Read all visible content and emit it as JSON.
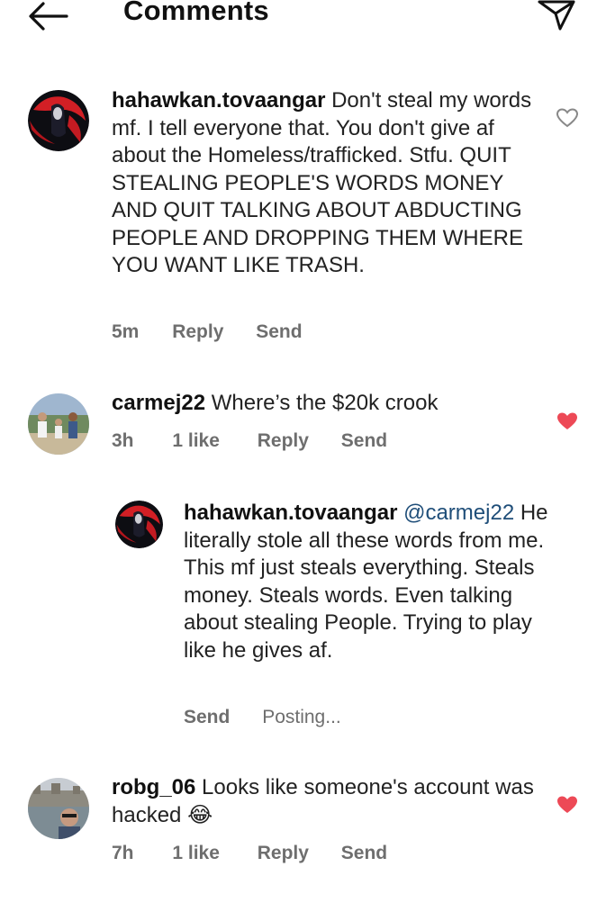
{
  "header": {
    "title": "Comments"
  },
  "comments": [
    {
      "username": "hahawkan.tovaangar",
      "text": "Don't steal my words mf. I tell everyone that. You don't give af about the Homeless/trafficked. Stfu. QUIT STEALING PEOPLE'S WORDS MONEY AND QUIT TALKING ABOUT ABDUCTING PEOPLE AND DROPPING THEM WHERE YOU WANT LIKE TRASH.",
      "time": "5m",
      "reply": "Reply",
      "send": "Send",
      "liked": false
    },
    {
      "username": "carmej22",
      "text": "Where’s the $20k crook",
      "time": "3h",
      "likes": "1 like",
      "reply": "Reply",
      "send": "Send",
      "liked": true
    },
    {
      "username": "hahawkan.tovaangar",
      "mention": "@carmej22",
      "text": "He literally stole all these words from me. This mf just steals everything. Steals money. Steals words. Even talking about stealing People. Trying to play like he gives af.",
      "send": "Send",
      "status": "Posting..."
    },
    {
      "username": "robg_06",
      "text": "Looks like someone's account was hacked",
      "emoji": "😂",
      "time": "7h",
      "likes": "1 like",
      "reply": "Reply",
      "send": "Send",
      "liked": true
    }
  ],
  "colors": {
    "like_red": "#ed4956",
    "meta_gray": "#6e6e6e",
    "mention_blue": "#1f4e79"
  }
}
